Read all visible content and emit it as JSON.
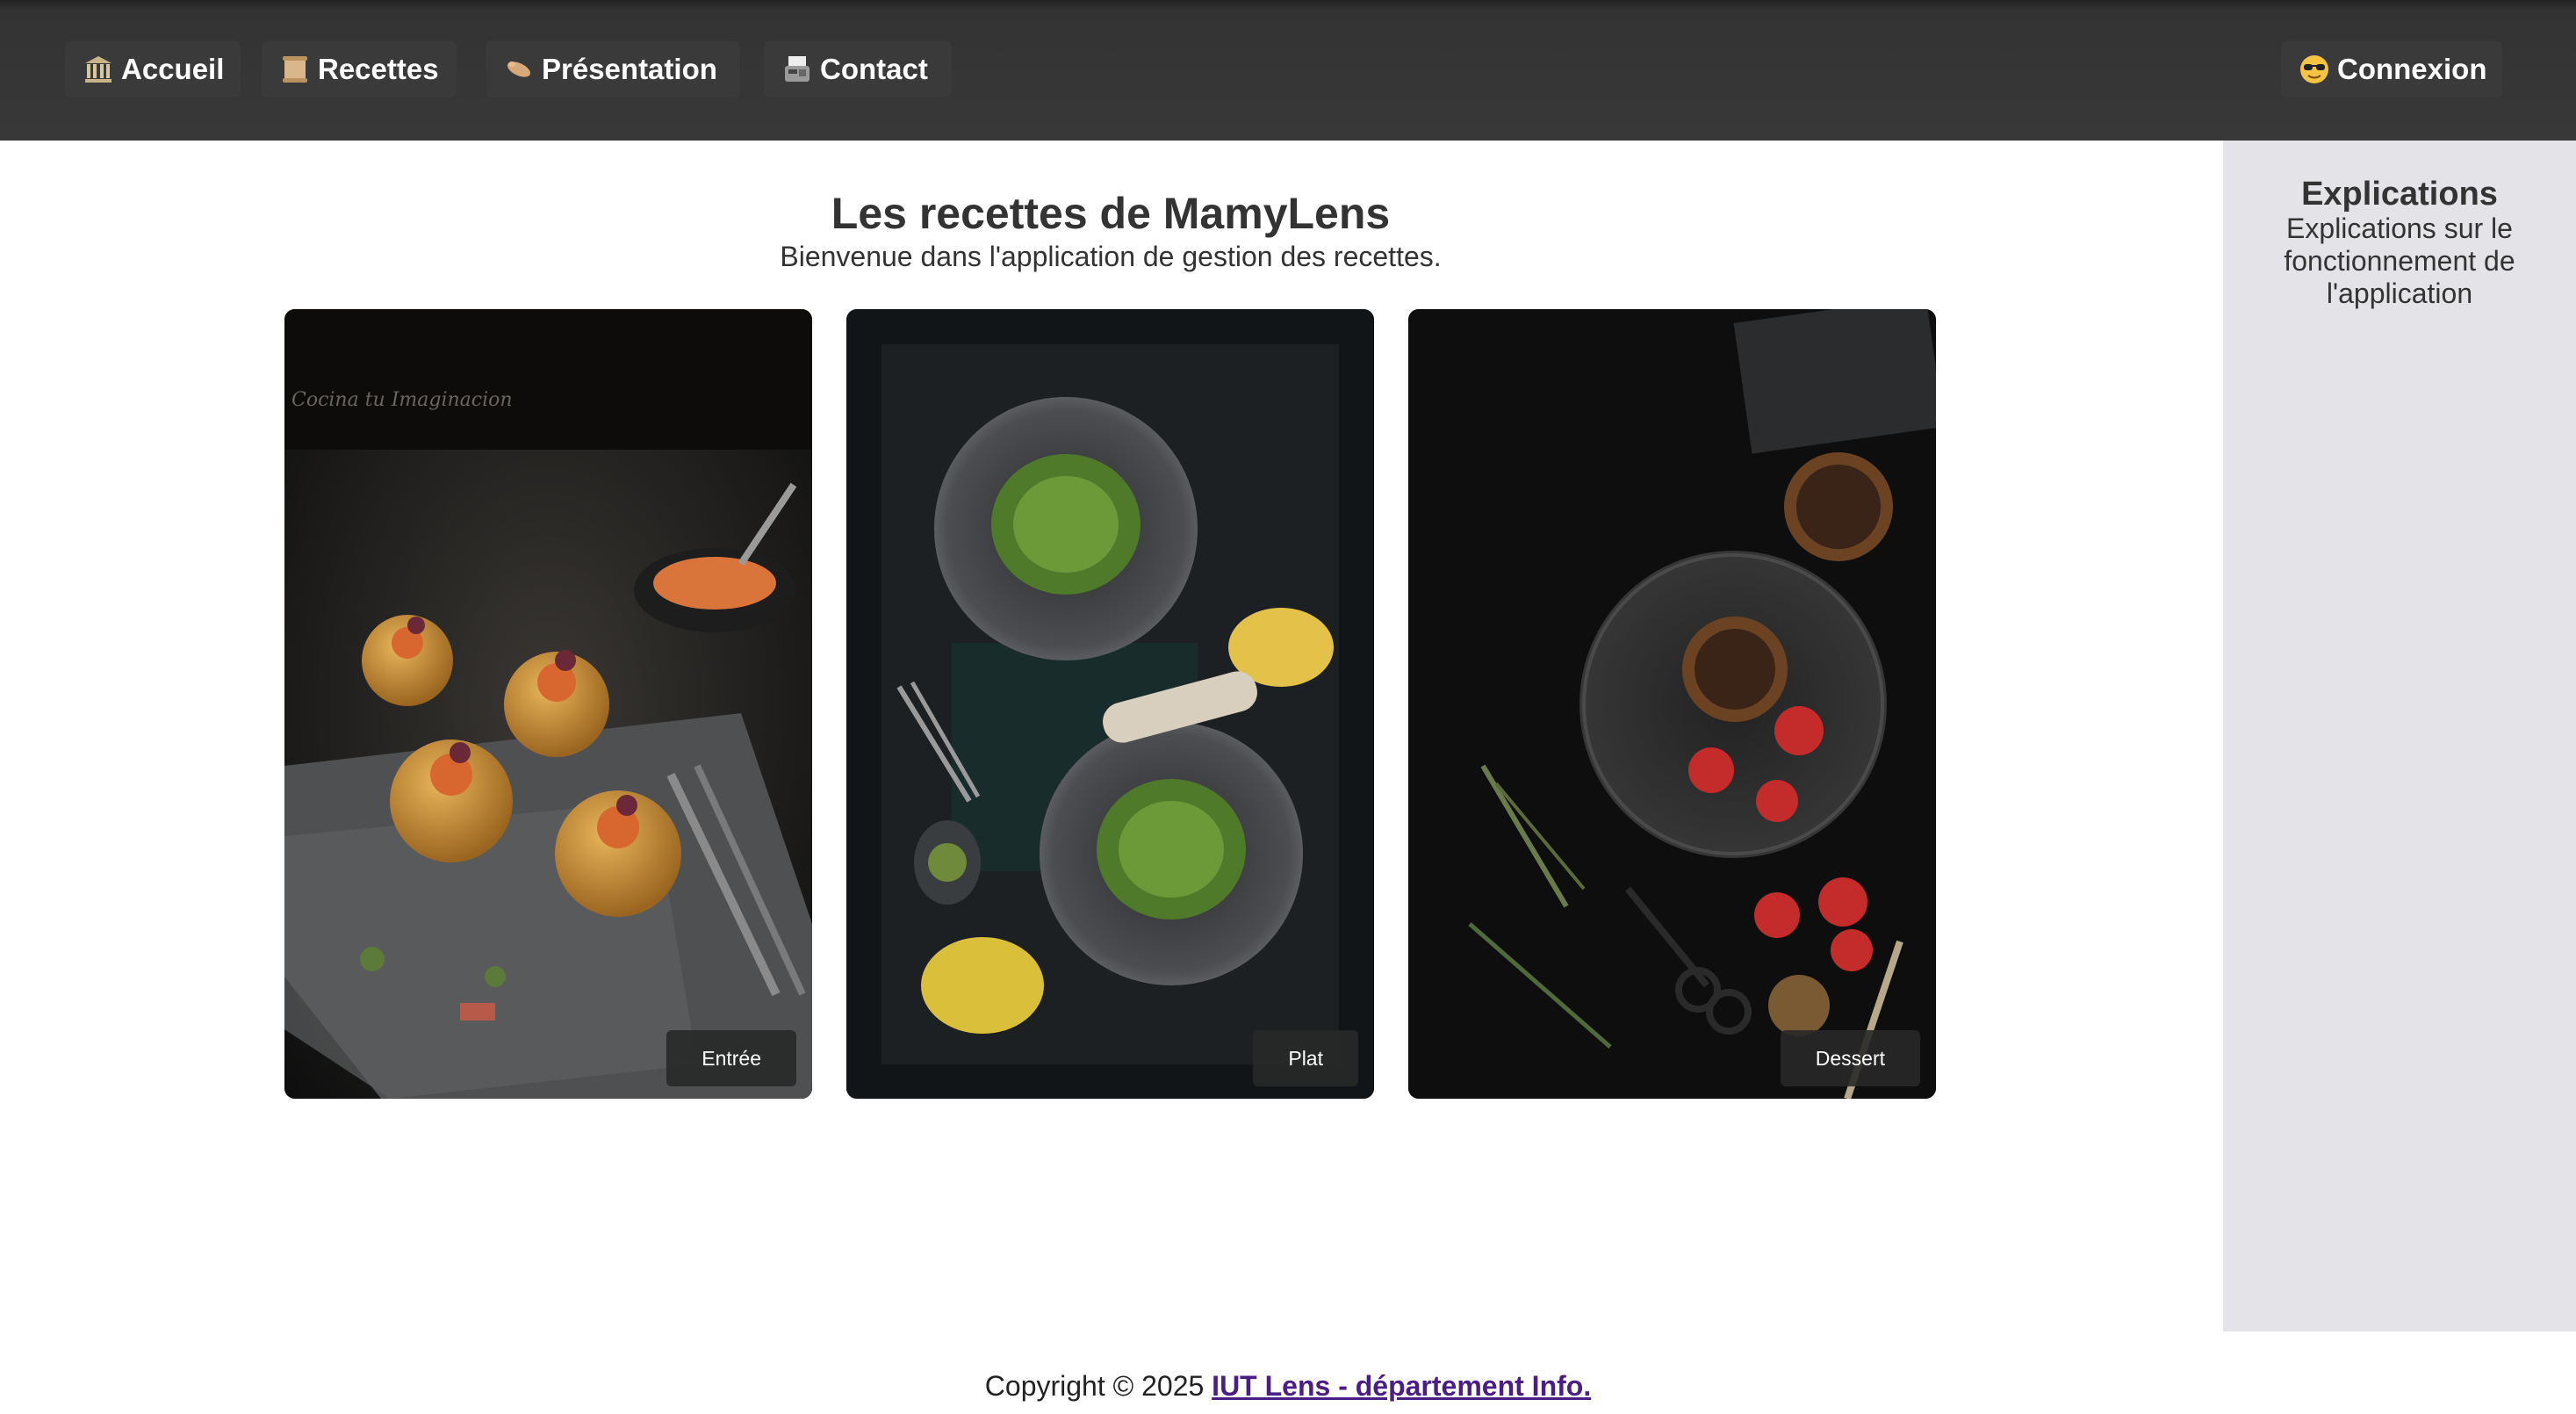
{
  "nav": {
    "home_label": "Accueil",
    "recipes_label": "Recettes",
    "presentation_label": "Présentation",
    "contact_label": "Contact",
    "login_label": "Connexion",
    "icons": {
      "home": "classical-building-icon",
      "recipes": "scroll-icon",
      "presentation": "waving-hand-icon",
      "contact": "fax-machine-icon",
      "login": "sunglasses-face-icon"
    }
  },
  "main": {
    "title": "Les recettes de MamyLens",
    "subtitle": "Bienvenue dans l'application de gestion des recettes.",
    "cards": [
      {
        "label": "Entrée"
      },
      {
        "label": "Plat"
      },
      {
        "label": "Dessert"
      }
    ]
  },
  "sidebar": {
    "title": "Explications",
    "text": "Explications sur le fonctionnement de l'application"
  },
  "footer": {
    "copyright": "Copyright © 2025",
    "link": "IUT Lens - département Info."
  },
  "colors": {
    "navbar": "#383838",
    "sidebar": "#e4e4e8",
    "link": "#4b1e86"
  }
}
